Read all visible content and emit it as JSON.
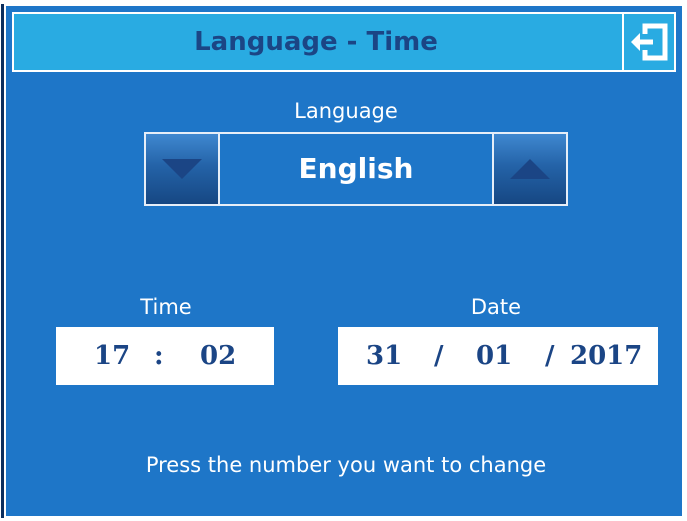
{
  "header": {
    "title": "Language - Time",
    "exit_icon": "exit-door-arrow-icon"
  },
  "language": {
    "label": "Language",
    "value": "English",
    "decrease_icon": "triangle-down-icon",
    "increase_icon": "triangle-up-icon"
  },
  "time": {
    "label": "Time",
    "hour": "17",
    "separator": ":",
    "minute": "02"
  },
  "date": {
    "label": "Date",
    "day": "31",
    "separator1": "/",
    "month": "01",
    "separator2": "/",
    "year": "2017"
  },
  "hint": "Press the number you want to change",
  "colors": {
    "background": "#1e76c8",
    "header_bg": "#29abe2",
    "title_text": "#1b4585",
    "field_text": "#1b4585",
    "arrow_fill": "#1b4585"
  }
}
